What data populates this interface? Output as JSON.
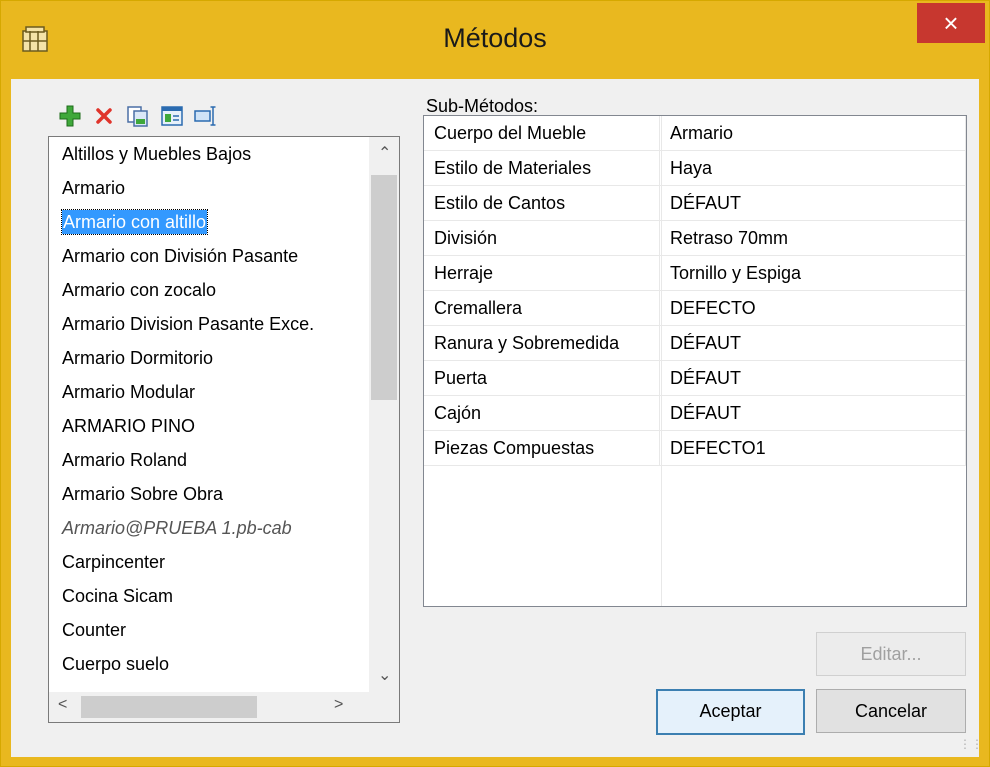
{
  "window": {
    "title": "Métodos",
    "close_label": "×"
  },
  "toolbar": {
    "icons": [
      "add-icon",
      "delete-icon",
      "copy-icon",
      "properties-icon",
      "rename-icon"
    ]
  },
  "methods_list": {
    "items": [
      "Altillos y Muebles Bajos",
      "Armario",
      "Armario con altillo",
      "Armario con División Pasante",
      "Armario con zocalo",
      "Armario Division Pasante Exce.",
      "Armario Dormitorio",
      "Armario Modular",
      "ARMARIO PINO",
      "Armario Roland",
      "Armario Sobre Obra",
      "Armario@PRUEBA 1.pb-cab",
      "Carpincenter",
      "Cocina Sicam",
      "Counter",
      "Cuerpo suelo"
    ],
    "selected": "Armario con altillo"
  },
  "sub_methods": {
    "label": "Sub-Métodos:",
    "rows": [
      {
        "name": "Cuerpo del Mueble",
        "value": "Armario"
      },
      {
        "name": "Estilo de Materiales",
        "value": "Haya"
      },
      {
        "name": "Estilo de Cantos",
        "value": "DÉFAUT"
      },
      {
        "name": "División",
        "value": "Retraso 70mm"
      },
      {
        "name": "Herraje",
        "value": "Tornillo y Espiga"
      },
      {
        "name": "Cremallera",
        "value": "DEFECTO"
      },
      {
        "name": "Ranura y Sobremedida",
        "value": "DÉFAUT"
      },
      {
        "name": "Puerta",
        "value": "DÉFAUT"
      },
      {
        "name": "Cajón",
        "value": "DÉFAUT"
      },
      {
        "name": "Piezas Compuestas",
        "value": "DEFECTO1"
      }
    ]
  },
  "buttons": {
    "edit": "Editar...",
    "accept": "Aceptar",
    "cancel": "Cancelar"
  },
  "colors": {
    "title_bar": "#e9b81f",
    "close_button": "#c7372f",
    "selection": "#3399ff"
  }
}
